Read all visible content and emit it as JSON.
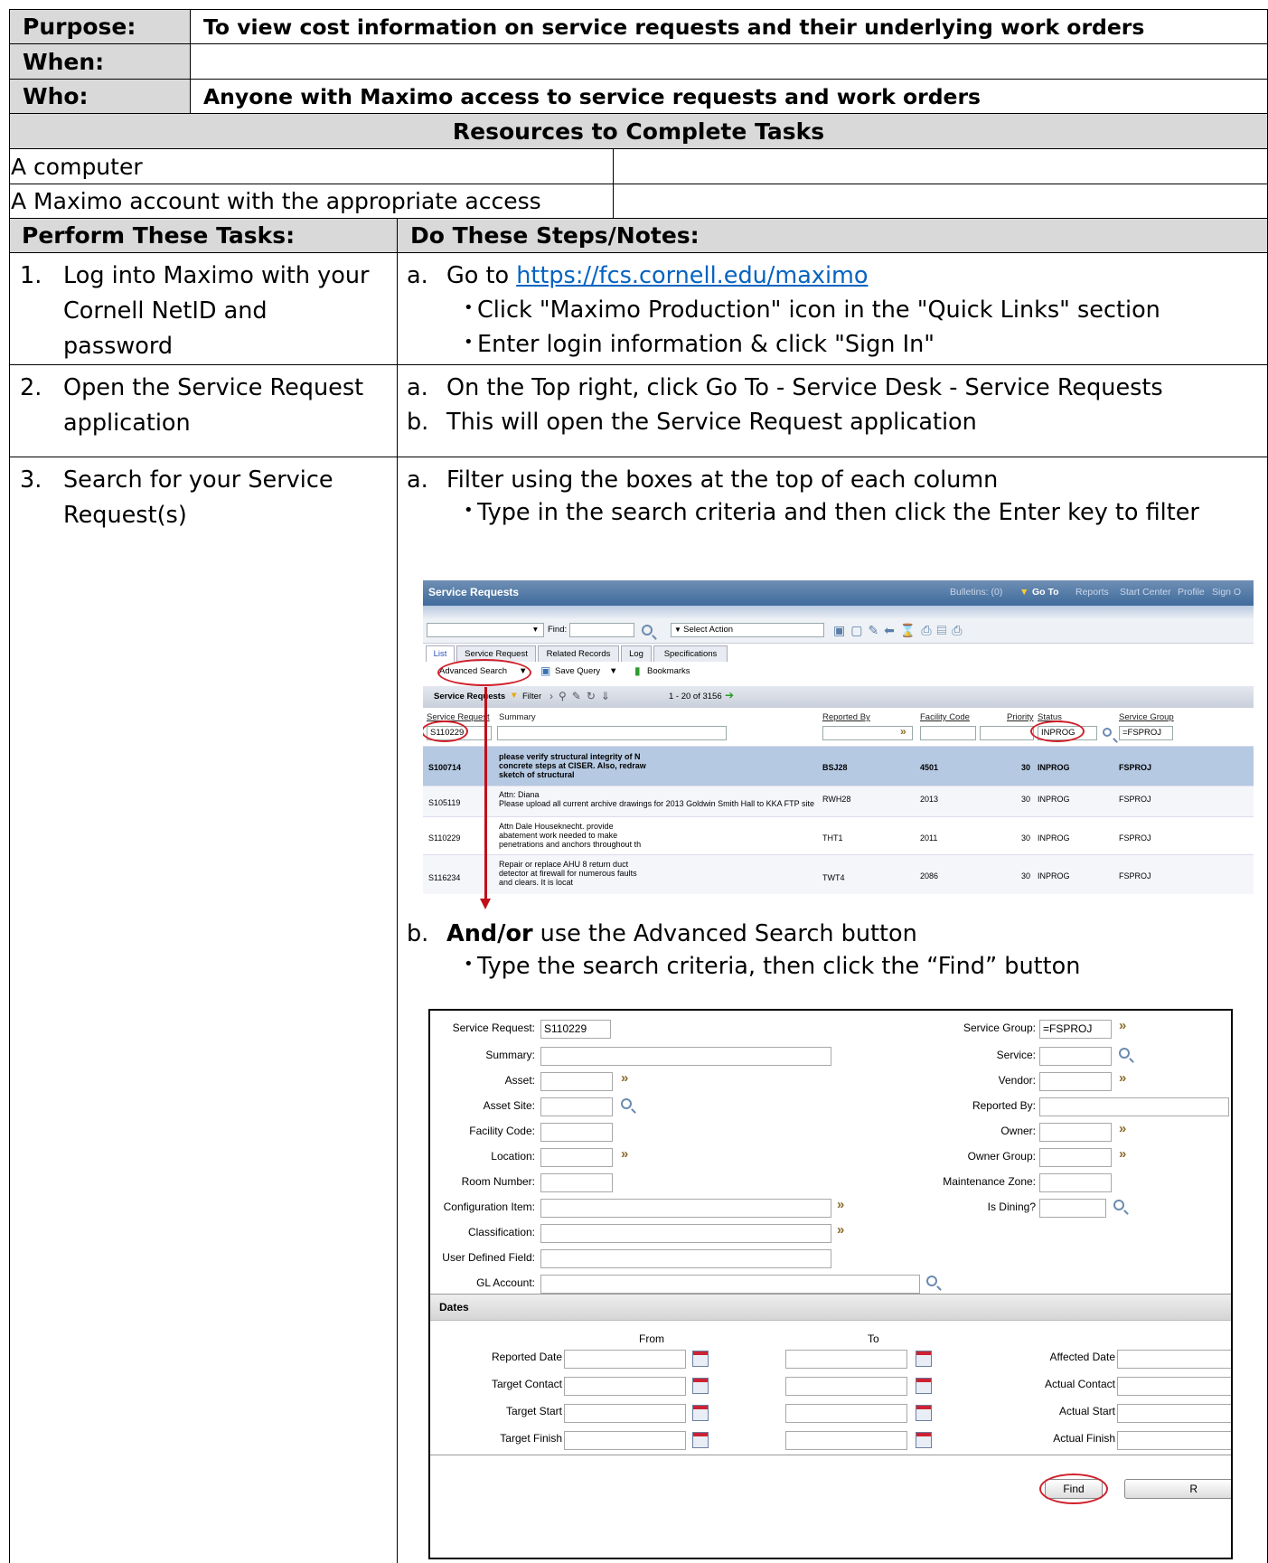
{
  "header": {
    "purpose_label": "Purpose:",
    "purpose_value": "To view cost information on service requests and their underlying work orders",
    "when_label": "When:",
    "when_value": "",
    "who_label": "Who:",
    "who_value": "Anyone with Maximo access to service requests and work orders"
  },
  "resources": {
    "title": "Resources to Complete Tasks",
    "items": [
      "A computer",
      "A Maximo account with the appropriate access"
    ]
  },
  "tasks_header": {
    "left": "Perform These Tasks:",
    "right": "Do These Steps/Notes:"
  },
  "steps": [
    {
      "num": "1.",
      "task": [
        "Log into Maximo with your",
        "Cornell NetID and",
        "password"
      ],
      "a_letter": "a.",
      "a_prefix": "Go to ",
      "a_link": "https://fcs.cornell.edu/maximo",
      "bullets": [
        "Click \"Maximo Production\" icon in the \"Quick Links\" section",
        "Enter login information & click \"Sign In\""
      ]
    },
    {
      "num": "2.",
      "task": [
        "Open the Service Request",
        "application"
      ],
      "notes": [
        {
          "letter": "a.",
          "text": "On the Top right, click Go To - Service Desk - Service Requests"
        },
        {
          "letter": "b.",
          "text": "This will open the Service Request application"
        }
      ]
    },
    {
      "num": "3.",
      "task": [
        "Search for your Service",
        "Request(s)"
      ],
      "a_letter": "a.",
      "a_text": "Filter using the boxes at the top of each column",
      "a_bullet": "Type in the search criteria and then click the Enter key to filter",
      "b_letter": "b.",
      "b_bold": "And/or",
      "b_text": " use the Advanced Search button",
      "b_bullet": "Type the search criteria, then click the “Find” button"
    }
  ],
  "screenshot1": {
    "app_title": "Service Requests",
    "nav": [
      "Bulletins: (0)",
      "Go To",
      "Reports",
      "Start Center",
      "Profile",
      "Sign O"
    ],
    "find_label": "Find:",
    "select_action": "Select Action",
    "tabs": [
      "List",
      "Service Request",
      "Related Records",
      "Log",
      "Specifications"
    ],
    "advanced_search": "Advanced Search",
    "save_query": "Save Query",
    "bookmarks": "Bookmarks",
    "table_title": "Service Requests",
    "filter": "Filter",
    "pagination": "1 - 20 of 3156",
    "columns": [
      "Service Request",
      "Summary",
      "Reported By",
      "Facility Code",
      "Priority",
      "Status",
      "Service Group"
    ],
    "filters": {
      "sr": "S110229",
      "status": "INPROG",
      "group": "=FSPROJ"
    },
    "rows": [
      {
        "sr": "S100714",
        "summary": [
          "please verify structural integrity of N",
          "concrete steps at CISER. Also, redraw",
          "sketch of structural"
        ],
        "by": "BSJ28",
        "fac": "4501",
        "pri": "30",
        "status": "INPROG",
        "group": "FSPROJ"
      },
      {
        "sr": "S105119",
        "summary": [
          "Attn: Diana",
          "Please upload all current archive drawings for 2013 Goldwin Smith Hall to KKA FTP site"
        ],
        "by": "RWH28",
        "fac": "2013",
        "pri": "30",
        "status": "INPROG",
        "group": "FSPROJ"
      },
      {
        "sr": "S110229",
        "summary": [
          "Attn Dale Houseknecht. provide",
          "abatement work needed to make",
          "penetrations and anchors throughout th"
        ],
        "by": "THT1",
        "fac": "2011",
        "pri": "30",
        "status": "INPROG",
        "group": "FSPROJ"
      },
      {
        "sr": "S116234",
        "summary": [
          "Repair or replace AHU 8 return duct",
          "detector at firewall for numerous faults",
          "and clears. It is locat"
        ],
        "by": "TWT4",
        "fac": "2086",
        "pri": "30",
        "status": "INPROG",
        "group": "FSPROJ"
      }
    ]
  },
  "screenshot2": {
    "left_fields": [
      "Service Request:",
      "Summary:",
      "Asset:",
      "Asset Site:",
      "Facility Code:",
      "Location:",
      "Room Number:",
      "Configuration Item:",
      "Classification:",
      "User Defined Field:",
      "GL Account:"
    ],
    "service_request_value": "S110229",
    "right_fields": [
      "Service Group:",
      "Service:",
      "Vendor:",
      "Reported By:",
      "Owner:",
      "Owner Group:",
      "Maintenance Zone:",
      "Is Dining?"
    ],
    "service_group_value": "=FSPROJ",
    "dates_title": "Dates",
    "from": "From",
    "to": "To",
    "date_rows": [
      "Reported Date",
      "Target Contact",
      "Target Start",
      "Target Finish"
    ],
    "right_date_rows": [
      "Affected Date",
      "Actual Contact",
      "Actual Start",
      "Actual Finish"
    ],
    "find_button": "Find",
    "cut_button": "R"
  }
}
